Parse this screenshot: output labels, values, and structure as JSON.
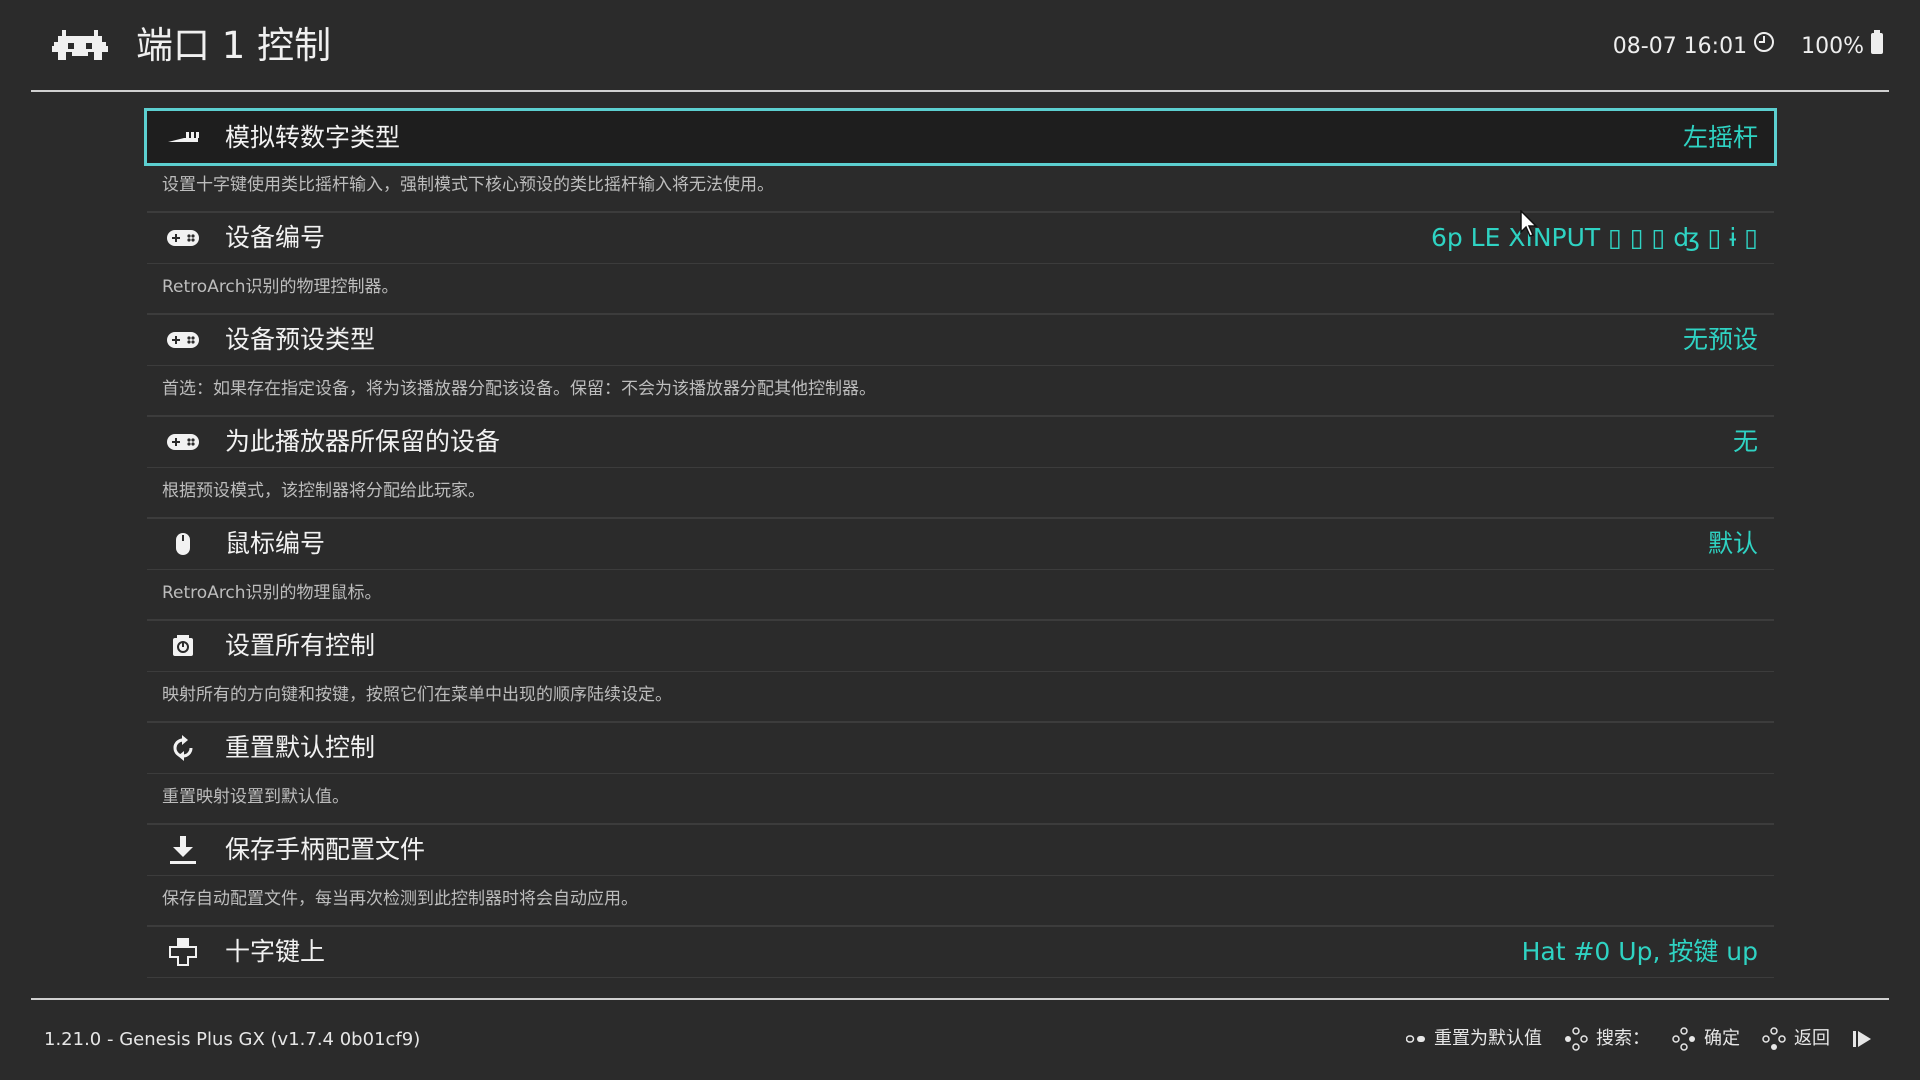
{
  "header": {
    "title": "端口 1 控制",
    "datetime": "08-07 16:01",
    "battery": "100%",
    "icons": [
      "retroarch-logo-icon",
      "clock-icon",
      "battery-icon"
    ]
  },
  "items": [
    {
      "label": "模拟转数字类型",
      "value": "左摇杆",
      "description": "设置十字键使用类比摇杆输入，强制模式下核心预设的类比摇杆输入将无法使用。",
      "icon": "analog-stick-icon"
    },
    {
      "label": "设备编号",
      "value": "6p LE XINPUT  ▯ ▯ ▯ ʤ ▯ ɨ ▯",
      "description": "RetroArch识别的物理控制器。",
      "icon": "gamepad-icon"
    },
    {
      "label": "设备预设类型",
      "value": "无预设",
      "description": "首选：如果存在指定设备，将为该播放器分配该设备。保留：不会为该播放器分配其他控制器。",
      "icon": "gamepad-icon"
    },
    {
      "label": "为此播放器所保留的设备",
      "value": "无",
      "description": "根据预设模式，该控制器将分配给此玩家。",
      "icon": "gamepad-icon"
    },
    {
      "label": "鼠标编号",
      "value": "默认",
      "description": "RetroArch识别的物理鼠标。",
      "icon": "mouse-icon"
    },
    {
      "label": "设置所有控制",
      "value": "",
      "description": "映射所有的方向键和按键，按照它们在菜单中出现的顺序陆续设定。",
      "icon": "bind-all-icon"
    },
    {
      "label": "重置默认控制",
      "value": "",
      "description": "重置映射设置到默认值。",
      "icon": "reset-icon"
    },
    {
      "label": "保存手柄配置文件",
      "value": "",
      "description": "保存自动配置文件，每当再次检测到此控制器时将会自动应用。",
      "icon": "download-icon"
    },
    {
      "label": "十字键上",
      "value": "Hat #0 Up, 按键 up",
      "description": "",
      "icon": "dpad-icon"
    }
  ],
  "footer": {
    "version": "1.21.0 - Genesis Plus GX (v1.7.4 0b01cf9)",
    "hints": [
      {
        "label": "重置为默认值",
        "icon": "select-button-icon"
      },
      {
        "label": "搜索：",
        "icon": "face-buttons-icon"
      },
      {
        "label": "确定",
        "icon": "face-buttons-icon"
      },
      {
        "label": "返回",
        "icon": "face-buttons-icon"
      }
    ],
    "resume_icon": "resume-icon"
  },
  "colors": {
    "background": "#2b2b2b",
    "accent": "#2fd3c3",
    "selection_border": "#5ccfd0",
    "text": "#f2f2f2",
    "subtext": "#bdbdbd"
  }
}
